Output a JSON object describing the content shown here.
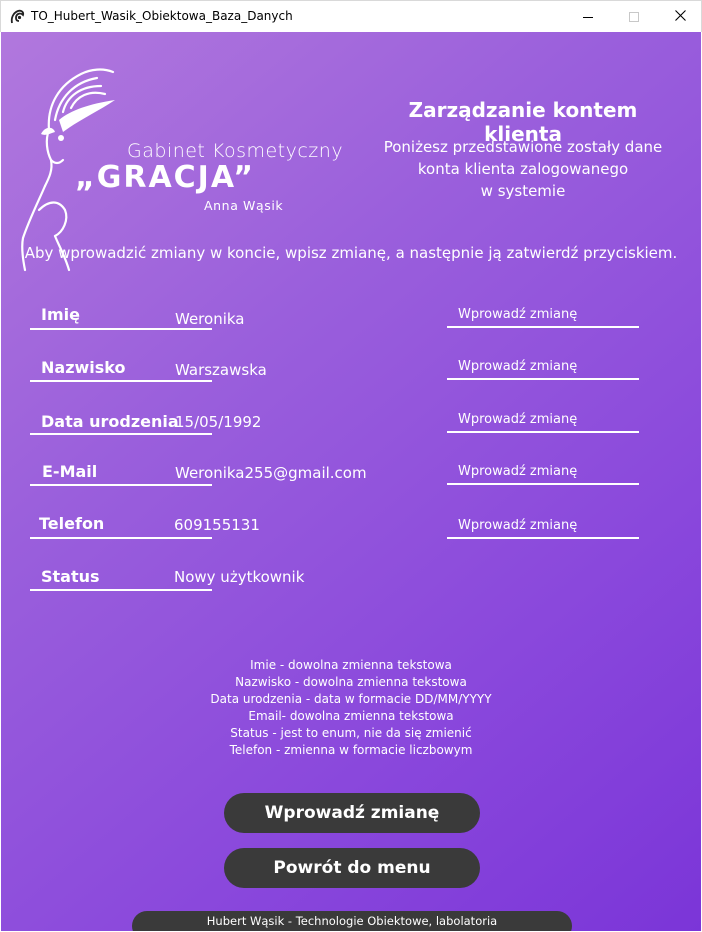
{
  "window": {
    "title": "TO_Hubert_Wasik_Obiektowa_Baza_Danych",
    "icon": "app-logo-icon",
    "controls": {
      "minimize": "minimize-icon",
      "maximize": "maximize-icon",
      "close": "close-icon"
    }
  },
  "logo": {
    "line1": "Gabinet Kosmetyczny",
    "line2": "„GRACJA”",
    "line3": "Anna Wąsik"
  },
  "header": {
    "title": "Zarządzanie kontem klienta",
    "subtitle_line1": "Poniżesz przedstawione zostały dane",
    "subtitle_line2": "konta klienta zalogowanego",
    "subtitle_line3": "w systemie"
  },
  "instruction": "Aby wprowadzić zmiany w koncie, wpisz zmianę, a następnie ją zatwierdź przyciskiem.",
  "fields": [
    {
      "label": "Imię",
      "value": "Weronika",
      "placeholder": "Wprowadź zmianę"
    },
    {
      "label": "Nazwisko",
      "value": "Warszawska",
      "placeholder": "Wprowadź zmianę"
    },
    {
      "label": "Data urodzenia",
      "value": "15/05/1992",
      "placeholder": "Wprowadź zmianę"
    },
    {
      "label": "E-Mail",
      "value": "Weronika255@gmail.com",
      "placeholder": "Wprowadź zmianę"
    },
    {
      "label": "Telefon",
      "value": "609155131",
      "placeholder": "Wprowadź zmianę"
    },
    {
      "label": "Status",
      "value": "Nowy użytkownik"
    }
  ],
  "legend": [
    "Imie - dowolna zmienna tekstowa",
    "Nazwisko - dowolna zmienna tekstowa",
    "Data urodzenia - data w formacie DD/MM/YYYY",
    "Email- dowolna zmienna tekstowa",
    "Status - jest to enum, nie da się zmienić",
    "Telefon - zmienna w formacie liczbowym"
  ],
  "buttons": {
    "submit": "Wprowadź zmianę",
    "back": "Powrót do menu"
  },
  "footer": "Hubert Wąsik - Technologie Obiektowe, labolatoria",
  "colors": {
    "gradient_start": "#b178dd",
    "gradient_end": "#7b35d8",
    "button_bg": "#3a3a3a",
    "text": "#ffffff"
  }
}
